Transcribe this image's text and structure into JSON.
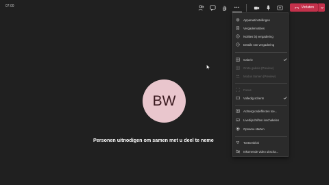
{
  "meeting": {
    "timer": "07:00",
    "avatar_initials": "BW",
    "invite_text": "Personen uitnodigen om samen met u deel te neme"
  },
  "toolbar": {
    "leave_label": "Verlaten",
    "accent_color": "#c4314b",
    "icons": [
      "participants-icon",
      "chat-icon",
      "raise-hand-icon",
      "more-actions-icon",
      "camera-icon",
      "microphone-icon",
      "share-icon",
      "phone-hangup-icon",
      "chevron-down-icon"
    ]
  },
  "menu": {
    "items": [
      {
        "label": "Apparaatinstellingen",
        "icon": "gear-icon",
        "disabled": false,
        "checked": false
      },
      {
        "label": "Vergadernotities",
        "icon": "notes-icon",
        "disabled": false,
        "checked": false
      },
      {
        "label": "Notities bij vergadering",
        "icon": "info-icon",
        "disabled": false,
        "checked": false
      },
      {
        "label": "Details van vergadering",
        "icon": "details-icon",
        "disabled": false,
        "checked": false
      },
      {
        "label": "Galerie",
        "icon": "gallery-icon",
        "disabled": false,
        "checked": true
      },
      {
        "label": "Grote galerie (Preview)",
        "icon": "large-gallery-icon",
        "disabled": true,
        "checked": false
      },
      {
        "label": "Modus Samen (Preview)",
        "icon": "together-mode-icon",
        "disabled": true,
        "checked": false
      },
      {
        "label": "Focus",
        "icon": "focus-icon",
        "disabled": true,
        "checked": false
      },
      {
        "label": "Volledig scherm",
        "icon": "fullscreen-icon",
        "disabled": false,
        "checked": true
      },
      {
        "label": "Achtergrondeffecten toe...",
        "icon": "background-effects-icon",
        "disabled": false,
        "checked": false
      },
      {
        "label": "Livebijschriften inschakelen",
        "icon": "captions-icon",
        "disabled": false,
        "checked": false
      },
      {
        "label": "Opname starten",
        "icon": "record-icon",
        "disabled": false,
        "checked": false
      },
      {
        "label": "Toetsenblok",
        "icon": "keypad-icon",
        "disabled": false,
        "checked": false
      },
      {
        "label": "Inkomende video uitscha...",
        "icon": "video-off-icon",
        "disabled": false,
        "checked": false
      }
    ]
  }
}
